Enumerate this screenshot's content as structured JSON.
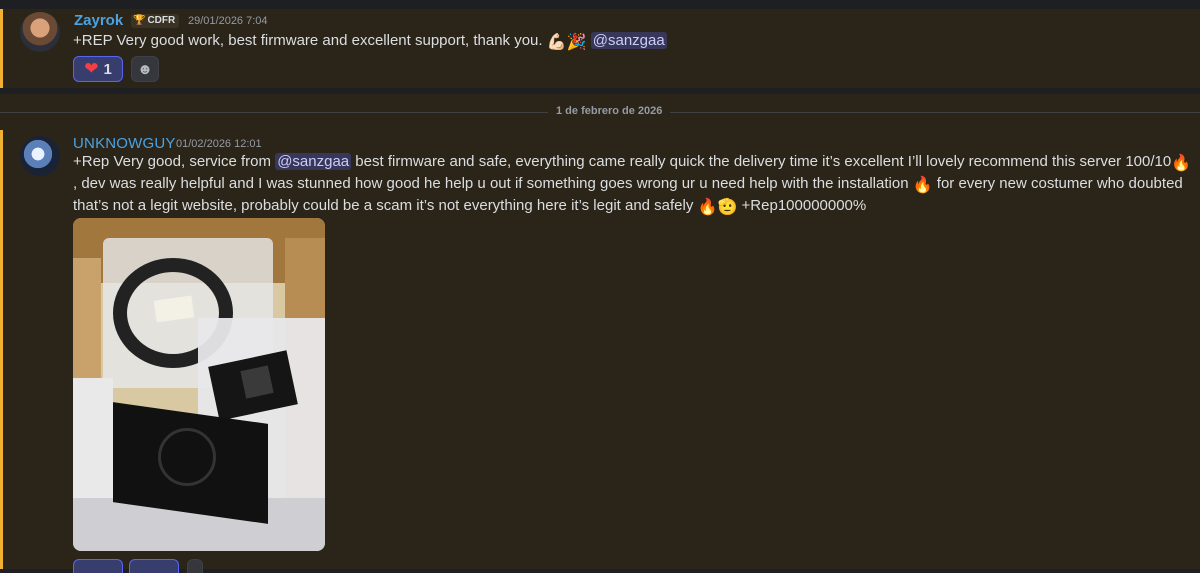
{
  "messages": [
    {
      "username": "Zayrok",
      "role_tag": "CDFR",
      "timestamp": "29/01/2026 7:04",
      "text_parts": [
        "+REP Very good work, best firmware and excellent support, thank you. ",
        "💪🏻🎉",
        " "
      ],
      "mention": "@sanzgaa",
      "reactions": [
        {
          "icon": "heart-icon",
          "emoji": "❤",
          "count": "1"
        }
      ],
      "add_reaction_icon": "smiley-icon"
    },
    {
      "username": "UNKNOWGUY",
      "timestamp": "01/02/2026 12:01",
      "text_before_mention": "+Rep Very good, service from ",
      "mention": "@sanzgaa",
      "text_after_mention": "  best firmware and safe, everything came really quick the delivery time it’s excellent I’ll lovely recommend this server 100/10",
      "fire_emoji": "🔥",
      "text_line2a": ", dev was really helpful and I was stunned how good he help u out if something goes wrong ur u need help with the installation ",
      "text_line2b": " for every new costumer who doubted that’s not a legit website, probably could be a scam it’s not everything here it’s legit and safely ",
      "salute_emoji": "🫡",
      "text_end": " +Rep100000000%",
      "attachment": "photo-attachment"
    }
  ],
  "date_divider": "1 de febrero de 2026",
  "colors": {
    "accent_username": "#4ba3e3",
    "highlight_bg": "#2b2418",
    "highlight_border": "#f0b132",
    "mention_bg": "#3d4270"
  }
}
